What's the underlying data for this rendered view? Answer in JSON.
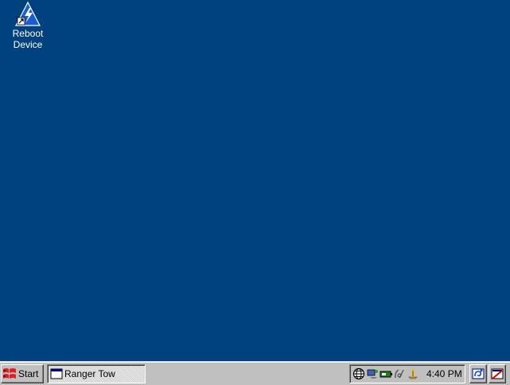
{
  "desktop": {
    "background_color": "#00417f",
    "icons": [
      {
        "label_line1": "Reboot",
        "label_line2": "Device",
        "icon": "reboot-device-icon"
      }
    ]
  },
  "taskbar": {
    "start_label": "Start",
    "start_icon": "windows-ce-flag-icon",
    "task_buttons": [
      {
        "label": "Ranger Tow",
        "icon": "window-icon"
      }
    ],
    "tray_icons": [
      "network-globe-icon",
      "connection-icon",
      "battery-icon",
      "pen-input-icon",
      "sync-icon"
    ],
    "clock": "4:40 PM",
    "quick_buttons": [
      {
        "icon": "input-panel-icon"
      },
      {
        "icon": "desktop-toggle-icon"
      }
    ]
  }
}
